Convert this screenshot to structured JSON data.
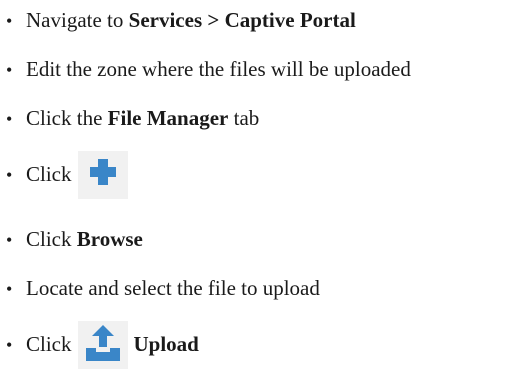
{
  "steps": [
    {
      "pre": "Navigate to ",
      "bold": "Services > Captive Portal",
      "post": ""
    },
    {
      "pre": "Edit the zone where the files will be uploaded",
      "bold": "",
      "post": ""
    },
    {
      "pre": "Click the ",
      "bold": "File Manager",
      "post": " tab"
    },
    {
      "pre": "Click",
      "icon": "plus-icon",
      "bold": "",
      "post": ""
    },
    {
      "pre": "Click ",
      "bold": "Browse",
      "post": ""
    },
    {
      "pre": "Locate and select the file to upload",
      "bold": "",
      "post": ""
    },
    {
      "pre": "Click",
      "icon": "upload-icon",
      "bold": "Upload",
      "post": ""
    }
  ],
  "bullet": "•",
  "colors": {
    "text": "#1a1a1a",
    "icon_blue": "#3a86c8",
    "icon_box": "#f1f1f1"
  }
}
